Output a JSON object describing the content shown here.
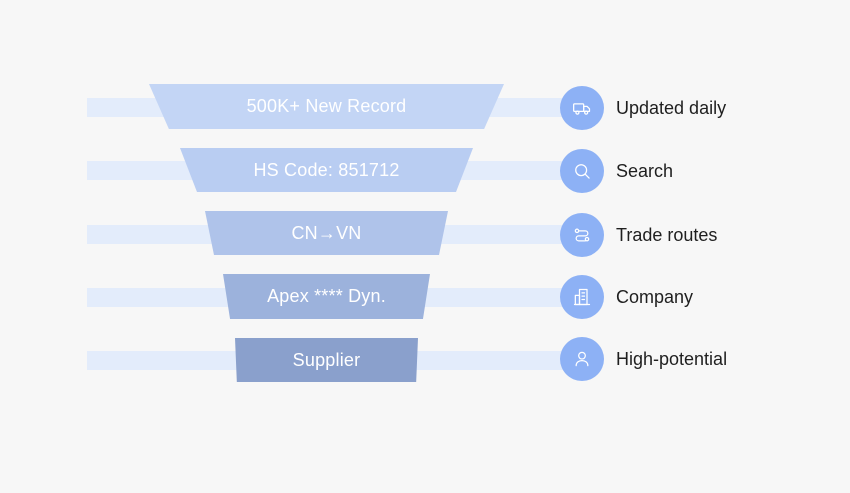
{
  "funnel": {
    "stages": [
      {
        "text": "500K+ New Record",
        "color": "#c3d5f5"
      },
      {
        "text": "HS Code: 851712",
        "color": "#b9cdf2"
      },
      {
        "text": "CN→VN",
        "color": "#afc3ea"
      },
      {
        "text": "Apex **** Dyn.",
        "color": "#9cb2dc"
      },
      {
        "text": "Supplier",
        "color": "#8aa0cc"
      }
    ]
  },
  "legend": {
    "items": [
      {
        "icon": "truck-icon",
        "label": "Updated daily"
      },
      {
        "icon": "search-icon",
        "label": "Search"
      },
      {
        "icon": "routes-icon",
        "label": "Trade routes"
      },
      {
        "icon": "building-icon",
        "label": "Company"
      },
      {
        "icon": "user-icon",
        "label": "High-potential"
      }
    ]
  },
  "colors": {
    "band": "#e3ecfb",
    "icon_circle": "#8db1f5",
    "background": "#f7f7f7"
  }
}
